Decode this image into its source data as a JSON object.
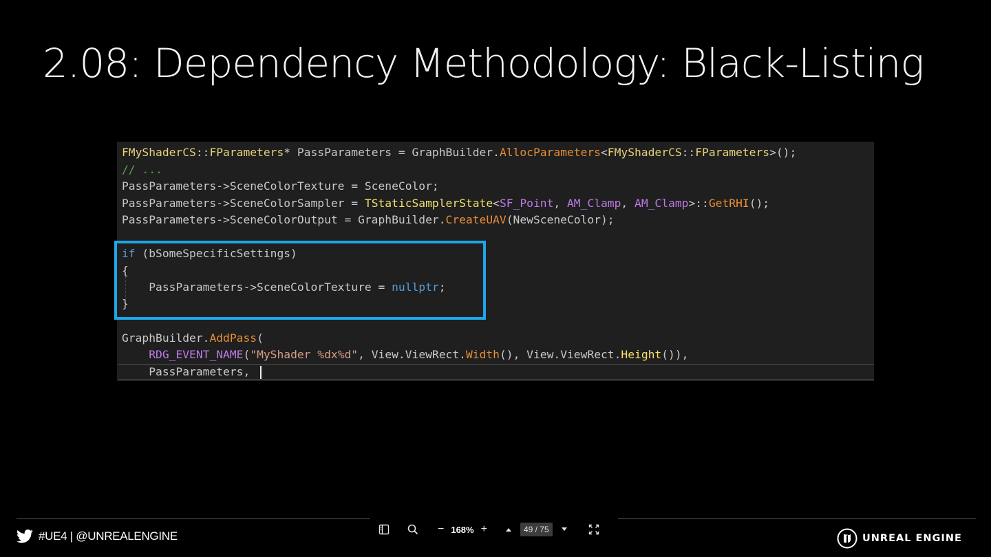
{
  "slide": {
    "title": "2.08: Dependency Methodology: Black-Listing"
  },
  "code": {
    "l1": [
      {
        "t": "FMyShaderCS",
        "c": "t-type"
      },
      {
        "t": "::",
        "c": "t-id"
      },
      {
        "t": "FParameters",
        "c": "t-type"
      },
      {
        "t": "* PassParameters = GraphBuilder.",
        "c": "t-id"
      },
      {
        "t": "AllocParameters",
        "c": "t-fn"
      },
      {
        "t": "<",
        "c": "t-id"
      },
      {
        "t": "FMyShaderCS",
        "c": "t-type"
      },
      {
        "t": "::",
        "c": "t-id"
      },
      {
        "t": "FParameters",
        "c": "t-type"
      },
      {
        "t": ">();",
        "c": "t-id"
      }
    ],
    "l2": [
      {
        "t": "// ...",
        "c": "t-cm"
      }
    ],
    "l3": [
      {
        "t": "PassParameters->SceneColorTexture = SceneColor;",
        "c": "t-id"
      }
    ],
    "l4": [
      {
        "t": "PassParameters->SceneColorSampler = ",
        "c": "t-id"
      },
      {
        "t": "TStaticSamplerState",
        "c": "t-yel"
      },
      {
        "t": "<",
        "c": "t-id"
      },
      {
        "t": "SF_Point",
        "c": "t-mac"
      },
      {
        "t": ", ",
        "c": "t-id"
      },
      {
        "t": "AM_Clamp",
        "c": "t-mac"
      },
      {
        "t": ", ",
        "c": "t-id"
      },
      {
        "t": "AM_Clamp",
        "c": "t-mac"
      },
      {
        "t": ">::",
        "c": "t-id"
      },
      {
        "t": "GetRHI",
        "c": "t-fn"
      },
      {
        "t": "();",
        "c": "t-id"
      }
    ],
    "l5": [
      {
        "t": "PassParameters->SceneColorOutput = GraphBuilder.",
        "c": "t-id"
      },
      {
        "t": "CreateUAV",
        "c": "t-fn"
      },
      {
        "t": "(NewSceneColor);",
        "c": "t-id"
      }
    ],
    "l6": [
      {
        "t": "if",
        "c": "t-kw"
      },
      {
        "t": " (bSomeSpecificSettings)",
        "c": "t-id"
      }
    ],
    "l7": [
      {
        "t": "{",
        "c": "t-id"
      }
    ],
    "l8": [
      {
        "t": "    PassParameters->SceneColorTexture = ",
        "c": "t-id"
      },
      {
        "t": "nullptr",
        "c": "t-kw"
      },
      {
        "t": ";",
        "c": "t-id"
      }
    ],
    "l9": [
      {
        "t": "}",
        "c": "t-id"
      }
    ],
    "l10": [
      {
        "t": "GraphBuilder.",
        "c": "t-id"
      },
      {
        "t": "AddPass",
        "c": "t-fn"
      },
      {
        "t": "(",
        "c": "t-id"
      }
    ],
    "l11": [
      {
        "t": "    ",
        "c": "t-id"
      },
      {
        "t": "RDG_EVENT_NAME",
        "c": "t-mac"
      },
      {
        "t": "(",
        "c": "t-id"
      },
      {
        "t": "\"MyShader %dx%d\"",
        "c": "t-str"
      },
      {
        "t": ", View.ViewRect.",
        "c": "t-id"
      },
      {
        "t": "Width",
        "c": "t-fn"
      },
      {
        "t": "(), View.ViewRect.",
        "c": "t-id"
      },
      {
        "t": "Height",
        "c": "t-yel"
      },
      {
        "t": "()),",
        "c": "t-id"
      }
    ],
    "l12": [
      {
        "t": "    PassParameters,",
        "c": "t-id"
      }
    ]
  },
  "footer": {
    "social": "#UE4 | @UNREALENGINE",
    "brand": "UNREAL ENGINE"
  },
  "viewer": {
    "zoom": "168%",
    "zoom_out": "−",
    "zoom_in": "+",
    "page": "49 / 75"
  }
}
